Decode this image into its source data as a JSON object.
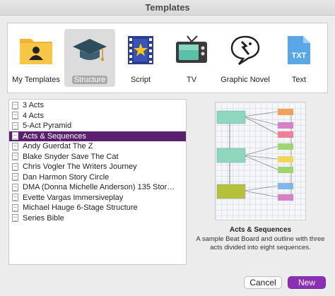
{
  "window": {
    "title": "Templates"
  },
  "categories": [
    {
      "label": "My Templates",
      "icon": "folder-person-icon",
      "selected": false
    },
    {
      "label": "Structure",
      "icon": "graduation-cap-icon",
      "selected": true
    },
    {
      "label": "Script",
      "icon": "film-strip-icon",
      "selected": false
    },
    {
      "label": "TV",
      "icon": "tv-icon",
      "selected": false
    },
    {
      "label": "Graphic Novel",
      "icon": "comic-bubble-icon",
      "selected": false
    },
    {
      "label": "Text",
      "icon": "txt-file-icon",
      "selected": false
    }
  ],
  "templates": [
    {
      "label": "3 Acts",
      "selected": false
    },
    {
      "label": "4 Acts",
      "selected": false
    },
    {
      "label": "5-Act Pyramid",
      "selected": false
    },
    {
      "label": "Acts & Sequences",
      "selected": true
    },
    {
      "label": "Andy Guerdat The Z",
      "selected": false
    },
    {
      "label": "Blake Snyder Save The Cat",
      "selected": false
    },
    {
      "label": "Chris Vogler The Writers Journey",
      "selected": false
    },
    {
      "label": "Dan Harmon Story Circle",
      "selected": false
    },
    {
      "label": "DMA (Donna Michelle Anderson) 135 Stor…",
      "selected": false
    },
    {
      "label": "Evette Vargas Immersiveplay",
      "selected": false
    },
    {
      "label": "Michael Hauge 6-Stage Structure",
      "selected": false
    },
    {
      "label": "Series Bible",
      "selected": false
    }
  ],
  "preview": {
    "title": "Acts & Sequences",
    "description": "A sample Beat Board and outline with three acts divided into eight sequences."
  },
  "buttons": {
    "cancel": "Cancel",
    "new": "New"
  },
  "colors": {
    "accent": "#8b2fb4",
    "selection": "#5a1f6e"
  }
}
